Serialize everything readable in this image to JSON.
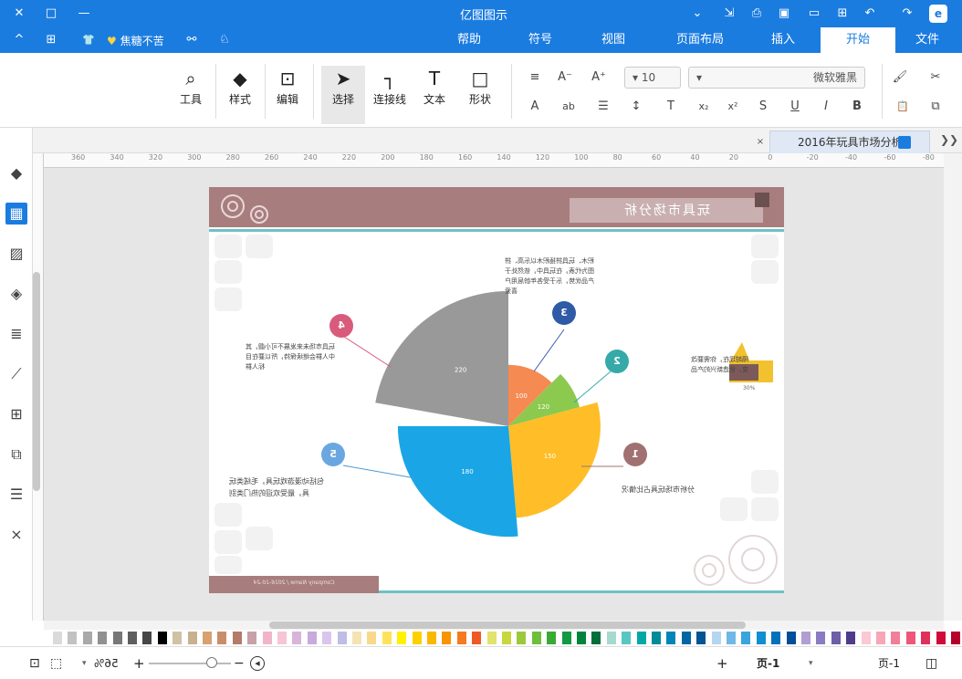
{
  "titlebar": {
    "app_title": "亿图图示",
    "window_controls": {
      "close": "✕",
      "maximize": "□",
      "minimize": "—"
    },
    "quick_access": {
      "chevron": "⌄",
      "export": "⇲",
      "print": "⎙",
      "save": "▣",
      "open": "▭",
      "new": "⊞",
      "undo": "↶",
      "redo": "↷",
      "logo": "e"
    }
  },
  "tabbar": {
    "collapse": "^",
    "apps": "⊞",
    "theme": "👕",
    "user_label": "焦糖不苦",
    "share": "⚯",
    "help": "♘",
    "tabs": [
      "帮助",
      "符号",
      "视图",
      "页面布局",
      "插入",
      "开始",
      "文件"
    ],
    "active_tab": "开始"
  },
  "ribbon": {
    "tools": {
      "label": "工具",
      "icon": "⌕"
    },
    "style": {
      "label": "样式",
      "icon": "◆"
    },
    "edit": {
      "label": "编辑",
      "icon": "⊡"
    },
    "select": {
      "label": "选择",
      "icon": "➤"
    },
    "connector": {
      "label": "连接线",
      "icon": "┐"
    },
    "text": {
      "label": "文本",
      "icon": "T"
    },
    "shape": {
      "label": "形状",
      "icon": "□"
    },
    "font_name": "微软雅黑",
    "font_size": "10",
    "format_icons": {
      "bold": "B",
      "italic": "I",
      "underline": "U",
      "strike": "S",
      "superscript": "x²",
      "subscript": "x₂",
      "clear": "T",
      "linespace": "↕",
      "list": "☰",
      "case": "ab",
      "color": "A",
      "align": "≡",
      "grow": "A⁺",
      "shrink": "A⁻",
      "cut": "✂",
      "copy": "⧉",
      "paste": "📋",
      "brush": "🖌"
    }
  },
  "doctab": {
    "title": "2016年玩具市场分析",
    "close": "×",
    "nav": "❯❯"
  },
  "lefttools": {
    "expand": "❯❯",
    "icons": [
      "◆",
      "▦",
      "▨",
      "◈",
      "≣",
      "⟋",
      "⊞",
      "⧉",
      "☰",
      "⨯"
    ]
  },
  "ruler": {
    "ticks": [
      "360",
      "340",
      "320",
      "300",
      "280",
      "260",
      "240",
      "220",
      "200",
      "180",
      "160",
      "140",
      "120",
      "100",
      "80",
      "60",
      "40",
      "20",
      "0",
      "-20",
      "-40",
      "-60",
      "-80"
    ]
  },
  "document": {
    "title": "玩具市场分析",
    "footer_text": "Company Name / 2016-10-24",
    "thumb_percent": "30%",
    "numbers": [
      "1",
      "2",
      "3",
      "4",
      "5"
    ],
    "annotations": {
      "n1": "分析市场玩具占比情况",
      "n2": "隔越现在，你需要改变，创造新兴的产品",
      "n3": "积木、玩具拼插积木以乐高、拼图为代表，在玩具中，依然处于产品优势，乐于受各年龄层用户喜爱",
      "n4": "玩具市场未来发展不可小觑，其中人群会继续保持，所以要在目标人群",
      "n5": "包括动漫游戏玩具，毛绒类玩具，最受欢迎的热门类别"
    }
  },
  "chart_data": {
    "type": "pie",
    "title": "",
    "variant": "rose",
    "categories": [
      "220",
      "100",
      "120",
      "150",
      "180"
    ],
    "values": [
      220,
      100,
      120,
      150,
      180
    ],
    "colors": [
      "#999999",
      "#f58a52",
      "#8cc94f",
      "#ffbe27",
      "#1aa6e6"
    ]
  },
  "palette": {
    "colors": [
      "#dadada",
      "#c2c2c2",
      "#a9a9a9",
      "#919191",
      "#787878",
      "#5f5f5f",
      "#474747",
      "#000000",
      "#cfc2a5",
      "#c9b18f",
      "#d8a16f",
      "#c88e6a",
      "#b47a6a",
      "#c7a1a7",
      "#f2b5c8",
      "#f7c6d6",
      "#d7b4d9",
      "#c8aadc",
      "#d9c6ec",
      "#bdbde6",
      "#f6e3b5",
      "#f8d98c",
      "#fde35b",
      "#fff200",
      "#fbd100",
      "#f9b800",
      "#f79400",
      "#f47b20",
      "#ee5a24",
      "#e0e36c",
      "#c8d63f",
      "#9cc93b",
      "#6dbf3c",
      "#3aaa35",
      "#139a43",
      "#00843d",
      "#006e3a",
      "#a6dacf",
      "#58c6c3",
      "#00a9a6",
      "#008b9a",
      "#0085b6",
      "#0066a5",
      "#005593",
      "#b4d6f1",
      "#6fb8e6",
      "#3aa5dd",
      "#108fd2",
      "#0072bc",
      "#004e9a",
      "#b09fd0",
      "#8b7bc0",
      "#6d5fa8",
      "#4f3d8c",
      "#fbc8d4",
      "#f7a6b7",
      "#f37e98",
      "#ee5779",
      "#e0315c",
      "#d10a3a",
      "#b4002b"
    ]
  },
  "statusbar": {
    "page_label": "页-1",
    "current_page": "页-1",
    "add_page": "+",
    "zoom": "56%",
    "fit": "⊡",
    "full": "⬚"
  }
}
